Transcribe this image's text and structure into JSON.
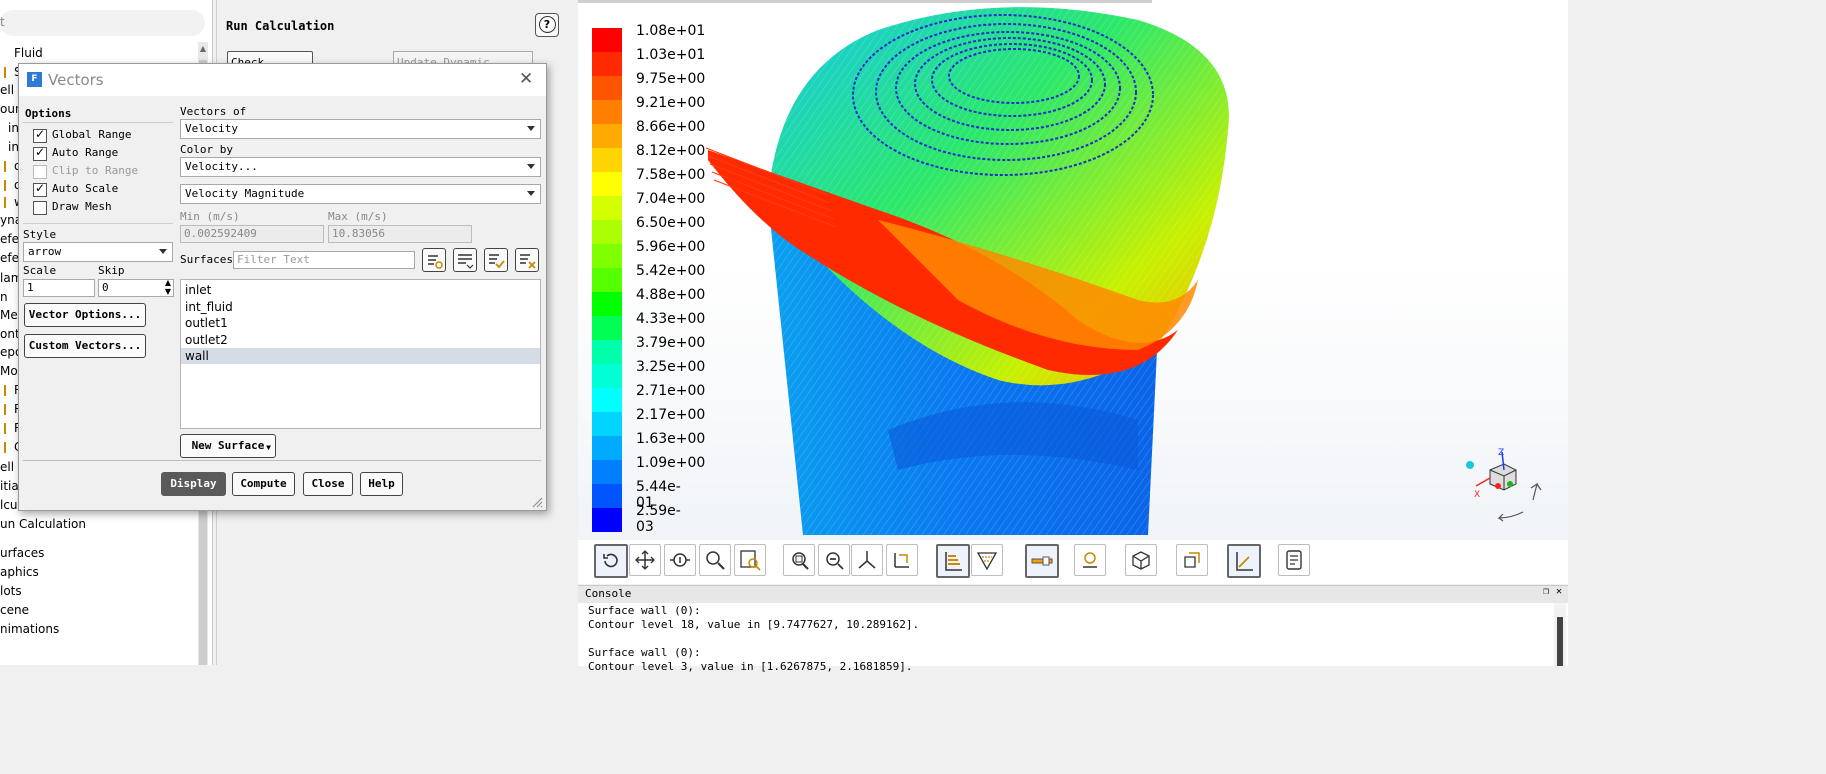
{
  "tree": {
    "search_placeholder": "t",
    "items": [
      {
        "label": "Fluid"
      },
      {
        "label": "S"
      },
      {
        "label": "ell Z"
      },
      {
        "label": "oun"
      },
      {
        "label": "in"
      },
      {
        "label": "in"
      },
      {
        "label": "o"
      },
      {
        "label": "o"
      },
      {
        "label": "w"
      },
      {
        "label": "yna"
      },
      {
        "label": "efe"
      },
      {
        "label": "efe"
      },
      {
        "label": "lam"
      },
      {
        "label": "n"
      },
      {
        "label": "Meth"
      },
      {
        "label": "ont"
      },
      {
        "label": "epo"
      },
      {
        "label": "Moni"
      },
      {
        "label": "R"
      },
      {
        "label": "R"
      },
      {
        "label": "R"
      },
      {
        "label": "C"
      },
      {
        "label": "ell R"
      },
      {
        "label": "itialization"
      },
      {
        "label": "lculation Activities"
      },
      {
        "label": "un Calculation"
      },
      {
        "label": "urfaces"
      },
      {
        "label": "aphics"
      },
      {
        "label": "lots"
      },
      {
        "label": "cene"
      },
      {
        "label": "nimations"
      }
    ]
  },
  "run_panel": {
    "title": "Run Calculation",
    "check_case": "Check Case...",
    "update_dynamic_mesh": "Update Dynamic Mesh..."
  },
  "dialog": {
    "title": "Vectors",
    "options_title": "Options",
    "options": [
      {
        "label": "Global Range",
        "checked": true,
        "enabled": true
      },
      {
        "label": "Auto Range",
        "checked": true,
        "enabled": true
      },
      {
        "label": "Clip to Range",
        "checked": false,
        "enabled": false
      },
      {
        "label": "Auto Scale",
        "checked": true,
        "enabled": true
      },
      {
        "label": "Draw Mesh",
        "checked": false,
        "enabled": true
      }
    ],
    "style_label": "Style",
    "style_value": "arrow",
    "scale_label": "Scale",
    "scale_value": "1",
    "skip_label": "Skip",
    "skip_value": "0",
    "vector_options": "Vector Options...",
    "custom_vectors": "Custom Vectors...",
    "vectors_of_label": "Vectors of",
    "vectors_of_value": "Velocity",
    "color_by_label": "Color by",
    "color_by_value": "Velocity...",
    "color_by_sub": "Velocity Magnitude",
    "min_label": "Min (m/s)",
    "min_value": "0.002592409",
    "max_label": "Max (m/s)",
    "max_value": "10.83056",
    "surfaces_label": "Surfaces",
    "filter_placeholder": "Filter Text",
    "surfaces": [
      {
        "name": "inlet",
        "selected": false
      },
      {
        "name": "int_fluid",
        "selected": false
      },
      {
        "name": "outlet1",
        "selected": false
      },
      {
        "name": "outlet2",
        "selected": false
      },
      {
        "name": "wall",
        "selected": true
      }
    ],
    "new_surface": "New Surface",
    "buttons": {
      "display": "Display",
      "compute": "Compute",
      "close": "Close",
      "help": "Help"
    }
  },
  "legend": {
    "labels": [
      "1.08e+01",
      "1.03e+01",
      "9.75e+00",
      "9.21e+00",
      "8.66e+00",
      "8.12e+00",
      "7.58e+00",
      "7.04e+00",
      "6.50e+00",
      "5.96e+00",
      "5.42e+00",
      "4.88e+00",
      "4.33e+00",
      "3.79e+00",
      "3.25e+00",
      "2.71e+00",
      "2.17e+00",
      "1.63e+00",
      "1.09e+00",
      "5.44e-01",
      "2.59e-03"
    ],
    "colors": [
      "#ff0000",
      "#ff2a00",
      "#ff5500",
      "#ff7f00",
      "#ffaa00",
      "#ffd400",
      "#ffff00",
      "#d4ff00",
      "#aaff00",
      "#7fff00",
      "#55ff00",
      "#00ff00",
      "#00ff55",
      "#00ffaa",
      "#00ffd4",
      "#00ffff",
      "#00d4ff",
      "#00aaff",
      "#007fff",
      "#0055ff",
      "#0000ff"
    ]
  },
  "console": {
    "title": "Console",
    "lines": [
      "Surface wall (0):",
      "Contour level 18, value in [9.7477627, 10.289162].",
      "",
      "Surface wall (0):",
      "Contour level 3, value in [1.6267875, 2.1681859]."
    ]
  }
}
